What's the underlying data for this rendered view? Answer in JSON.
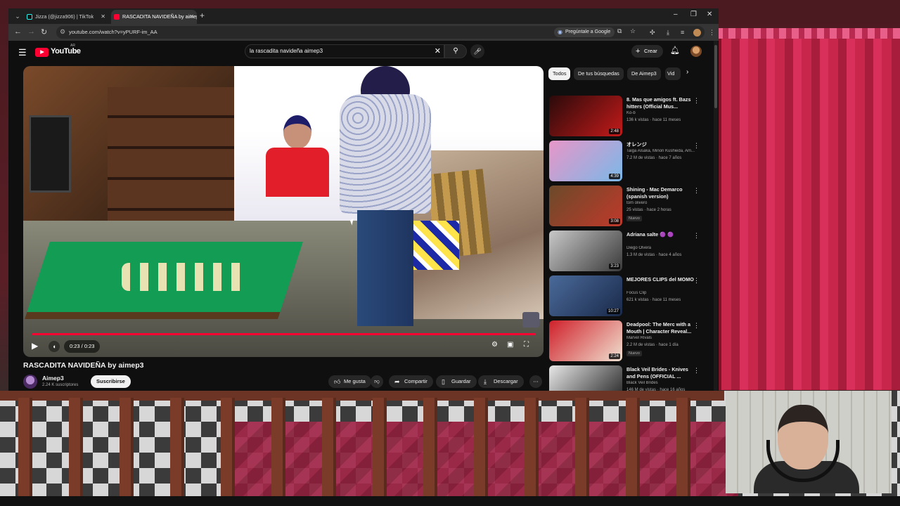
{
  "browser": {
    "tabs": [
      {
        "label": "Jizza (@jizza906) | TikTok",
        "active": false
      },
      {
        "label": "RASCADITA NAVIDEÑA by aimep3",
        "active": true
      }
    ],
    "url": "youtube.com/watch?v=yPURF-im_AA",
    "ask_google_label": "Pregúntale a Google"
  },
  "youtube": {
    "logo_text": "YouTube",
    "logo_country": "AR",
    "search_query": "la rascadita navideña aimep3",
    "create_label": "Crear"
  },
  "player": {
    "time": "0:23 / 0:23",
    "progress": 1.0
  },
  "video": {
    "title": "RASCADITA NAVIDEÑA by aimep3",
    "channel": "Aimep3",
    "subscribers": "2.24 K suscriptores",
    "subscribe_label": "Suscribirse",
    "actions": {
      "like": "Me gusta",
      "share": "Compartir",
      "save": "Guardar",
      "download": "Descargar"
    }
  },
  "sidebar": {
    "chips": [
      "Todos",
      "De tus búsquedas",
      "De Aimep3",
      "Vid"
    ],
    "recommendations": [
      {
        "title": "8. Mas que amigos ft. Bazs hitters (Official Mus...",
        "channel": "Ko-b",
        "meta": "136 k vistas · hace 11 meses",
        "duration": "2:48",
        "badge": "",
        "thumb_colors": [
          "#2a0a0a",
          "#c41a1a"
        ]
      },
      {
        "title": "オレンジ",
        "channel": "Taiga Aisaka, Minori Kushieda, Am...",
        "meta": "7.2 M de vistas · hace 7 años",
        "duration": "4:39",
        "badge": "",
        "thumb_colors": [
          "#e896c8",
          "#7ab8e8"
        ]
      },
      {
        "title": "Shining - Mac Demarco (spanish version)",
        "channel": "tom olivero",
        "meta": "25 vistas · hace 2 horas",
        "duration": "3:08",
        "badge": "Nuevo",
        "thumb_colors": [
          "#6b4a2a",
          "#c0392b"
        ]
      },
      {
        "title": "Adriana salte 🟣 🟣",
        "channel": "Diego Olvera",
        "meta": "1.3 M de vistas · hace 4 años",
        "duration": "3:23",
        "badge": "",
        "thumb_colors": [
          "#c8c8c8",
          "#3a3a3a"
        ]
      },
      {
        "title": "MEJORES CLIPS del MOMO",
        "channel": "Focus Clip",
        "meta": "621 k vistas · hace 11 meses",
        "duration": "10:27",
        "badge": "",
        "thumb_colors": [
          "#4a6a9a",
          "#1a2a4a"
        ]
      },
      {
        "title": "Deadpool: The Merc with a Mouth | Character Reveal...",
        "channel": "Marvel Rivals",
        "meta": "2.2 M de vistas · hace 1 día",
        "duration": "2:24",
        "badge": "Nuevo",
        "thumb_colors": [
          "#d0202a",
          "#f0e0d0"
        ]
      },
      {
        "title": "Black Veil Brides - Knives and Pens (OFFICIAL ...",
        "channel": "Black Veil Brides",
        "meta": "146 M de vistas · hace 16 años",
        "duration": "",
        "badge": "",
        "thumb_colors": [
          "#e8e8e8",
          "#1a1a1a"
        ]
      }
    ]
  }
}
